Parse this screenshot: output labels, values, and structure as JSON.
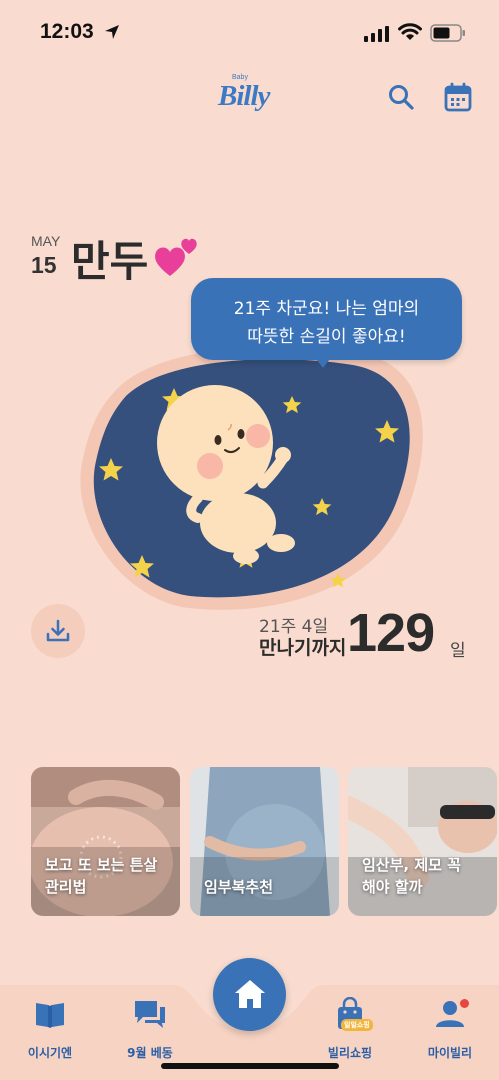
{
  "status_bar": {
    "time": "12:03"
  },
  "header": {
    "logo_small": "Baby",
    "logo_text": "Billy",
    "icons": [
      "search-icon",
      "calendar-icon"
    ]
  },
  "profile": {
    "month": "MAY",
    "day": "15",
    "baby_name": "만두"
  },
  "speech_bubble": {
    "line1": "21주 차군요! 나는 엄마의",
    "line2": "따뜻한 손길이 좋아요!"
  },
  "countdown": {
    "week_day": "21주 4일",
    "until_label": "만나기까지",
    "days": "129",
    "unit": "일"
  },
  "cards": [
    {
      "title": "보고 또 보는 튼살\n관리법"
    },
    {
      "title": "임부복추천"
    },
    {
      "title": "임산부, 제모 꼭\n해야 할까"
    }
  ],
  "nav": {
    "diary": "이시기엔",
    "delivery": "9월 베동",
    "shop": "빌리쇼핑",
    "shop_badge": "일일쇼핑",
    "my": "마이빌리"
  },
  "colors": {
    "background": "#f9dccf",
    "accent": "#3a72b8",
    "blob": "#35507d"
  }
}
